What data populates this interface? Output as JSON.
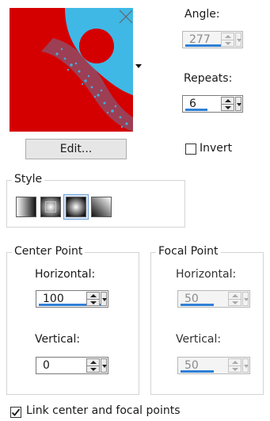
{
  "angle": {
    "label": "Angle:",
    "value": "277",
    "progress": 0.77
  },
  "repeats": {
    "label": "Repeats:",
    "value": "6",
    "progress": 0.45
  },
  "edit_button": "Edit...",
  "invert": {
    "label": "Invert",
    "checked": false
  },
  "style": {
    "title": "Style",
    "options": [
      "linear-gradient",
      "rectangular-gradient",
      "radial-gradient",
      "sunburst-gradient"
    ],
    "selected_index": 2
  },
  "center_point": {
    "title": "Center Point",
    "horizontal_label": "Horizontal:",
    "horizontal_value": "100",
    "horizontal_progress": 1.0,
    "vertical_label": "Vertical:",
    "vertical_value": "0",
    "vertical_progress": 0.0
  },
  "focal_point": {
    "title": "Focal Point",
    "horizontal_label": "Horizontal:",
    "horizontal_value": "50",
    "horizontal_progress": 0.5,
    "vertical_label": "Vertical:",
    "vertical_value": "50",
    "vertical_progress": 0.5
  },
  "link_points": {
    "label": "Link center and focal points",
    "checked": true
  },
  "colors": {
    "preview_red": "#d40000",
    "preview_cyan": "#3fb8e6",
    "accent": "#2f7fd6"
  },
  "icons": [
    "close-icon",
    "dropdown-arrow-icon",
    "spin-up-icon",
    "spin-down-icon",
    "checkmark-icon"
  ]
}
